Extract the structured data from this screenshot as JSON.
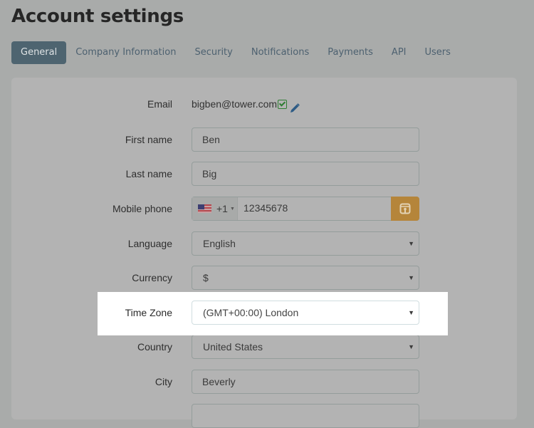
{
  "page": {
    "title": "Account settings"
  },
  "tabs": [
    {
      "label": "General",
      "active": true
    },
    {
      "label": "Company Information",
      "active": false
    },
    {
      "label": "Security",
      "active": false
    },
    {
      "label": "Notifications",
      "active": false
    },
    {
      "label": "Payments",
      "active": false
    },
    {
      "label": "API",
      "active": false
    },
    {
      "label": "Users",
      "active": false
    }
  ],
  "form": {
    "email": {
      "label": "Email",
      "value": "bigben@tower.com",
      "verified_icon": "verified-check-icon",
      "edit_icon": "pencil-icon"
    },
    "first_name": {
      "label": "First name",
      "value": "Ben"
    },
    "last_name": {
      "label": "Last name",
      "value": "Big"
    },
    "mobile_phone": {
      "label": "Mobile phone",
      "country_flag": "us-flag-icon",
      "dial_code": "+1",
      "value": "12345678",
      "action_icon": "verify-phone-icon"
    },
    "language": {
      "label": "Language",
      "value": "English"
    },
    "currency": {
      "label": "Currency",
      "value": "$"
    },
    "time_zone": {
      "label": "Time Zone",
      "value": "(GMT+00:00) London"
    },
    "country": {
      "label": "Country",
      "value": "United States"
    },
    "city": {
      "label": "City",
      "value": "Beverly"
    }
  },
  "colors": {
    "active_tab": "#4e6470",
    "phone_button": "#b5853a",
    "verified": "#2e7d32",
    "edit": "#2d5b85"
  }
}
